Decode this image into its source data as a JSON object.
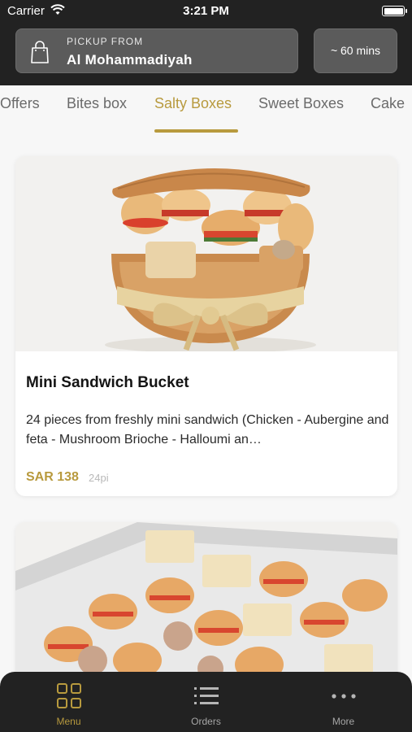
{
  "status_bar": {
    "carrier": "Carrier",
    "time": "3:21 PM"
  },
  "header": {
    "pickup_label": "PICKUP FROM",
    "pickup_location": "Al Mohammadiyah",
    "eta": "~ 60 mins"
  },
  "tabs": [
    {
      "label": "Offers"
    },
    {
      "label": "Bites box"
    },
    {
      "label": "Salty Boxes",
      "active": true
    },
    {
      "label": "Sweet Boxes"
    },
    {
      "label": "Cake"
    }
  ],
  "products": [
    {
      "name": "Mini Sandwich Bucket",
      "description": "24 pieces from freshly mini sandwich (Chicken - Aubergine and feta - Mushroom Brioche - Halloumi an…",
      "price": "SAR 138",
      "unit": "24pi"
    },
    {
      "name": "",
      "description": "",
      "price": "",
      "unit": ""
    }
  ],
  "bottom_nav": [
    {
      "label": "Menu",
      "icon": "grid-icon",
      "active": true
    },
    {
      "label": "Orders",
      "icon": "list-icon"
    },
    {
      "label": "More",
      "icon": "more-dots-icon"
    }
  ],
  "colors": {
    "accent": "#b89a3e",
    "header_bg": "#222222",
    "page_bg": "#f7f7f7"
  }
}
